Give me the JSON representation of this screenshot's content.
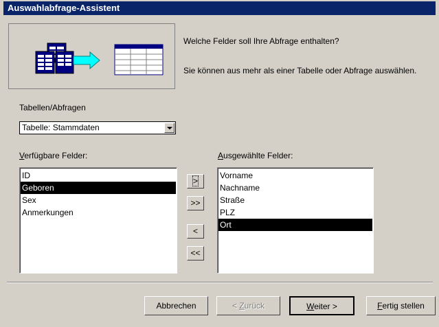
{
  "window": {
    "title": "Auswahlabfrage-Assistent"
  },
  "intro": {
    "question": "Welche Felder soll Ihre Abfrage enthalten?",
    "description": "Sie können aus mehr als einer Tabelle oder Abfrage auswählen."
  },
  "source": {
    "label": "Tabellen/Abfragen",
    "selected": "Tabelle: Stammdaten"
  },
  "available": {
    "label_acc": "V",
    "label_rest": "erfügbare Felder:",
    "items": [
      "ID",
      "Geboren",
      "Sex",
      "Anmerkungen"
    ],
    "selected_index": 1
  },
  "chosen": {
    "label_acc": "A",
    "label_rest": "usgewählte Felder:",
    "items": [
      "Vorname",
      "Nachname",
      "Straße",
      "PLZ",
      "Ort"
    ],
    "selected_index": 4
  },
  "move_buttons": {
    "add_one": ">",
    "add_all": ">>",
    "remove_one": "<",
    "remove_all": "<<"
  },
  "footer": {
    "cancel": "Abbrechen",
    "back_pre": "< ",
    "back_acc": "Z",
    "back_rest": "urück",
    "next_acc": "W",
    "next_rest": "eiter >",
    "finish_acc": "F",
    "finish_rest": "ertig stellen"
  }
}
